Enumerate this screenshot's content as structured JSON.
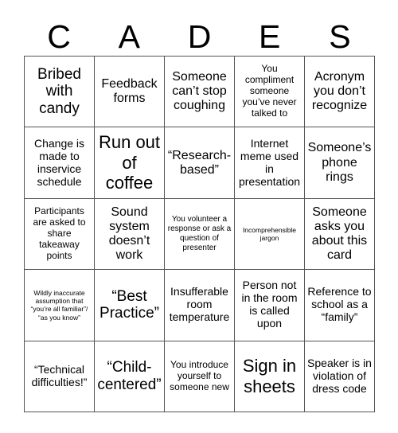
{
  "card": {
    "header_letters": [
      "C",
      "A",
      "D",
      "E",
      "S"
    ],
    "colors": {
      "background": "#ffffff",
      "text": "#000000",
      "grid_line": "#555555"
    },
    "rows": [
      [
        {
          "text": "Bribed with candy",
          "size": "xl"
        },
        {
          "text": "Feedback forms",
          "size": "lg"
        },
        {
          "text": "Someone can’t stop coughing",
          "size": "lg"
        },
        {
          "text": "You compliment someone you’ve never talked to",
          "size": "sm"
        },
        {
          "text": "Acronym you don’t recognize",
          "size": "lg"
        }
      ],
      [
        {
          "text": "Change is made to inservice schedule",
          "size": "md"
        },
        {
          "text": "Run out of coffee",
          "size": "xxl"
        },
        {
          "text": "“Research-based”",
          "size": "lg"
        },
        {
          "text": "Internet meme used in presentation",
          "size": "md"
        },
        {
          "text": "Someone’s phone rings",
          "size": "lg"
        }
      ],
      [
        {
          "text": "Participants are asked to share takeaway points",
          "size": "sm"
        },
        {
          "text": "Sound system doesn’t work",
          "size": "lg"
        },
        {
          "text": "You volunteer a response or ask a question of presenter",
          "size": "xs"
        },
        {
          "text": "Incomprehensible jargon",
          "size": "xxs"
        },
        {
          "text": "Someone asks you about this card",
          "size": "lg"
        }
      ],
      [
        {
          "text": "Wildly inaccurate assumption that “you’re all familiar”/ “as you know”",
          "size": "xxs"
        },
        {
          "text": "“Best Practice”",
          "size": "xl"
        },
        {
          "text": "Insufferable room temperature",
          "size": "md"
        },
        {
          "text": "Person not in the room is called upon",
          "size": "md"
        },
        {
          "text": "Reference to school as a “family”",
          "size": "md"
        }
      ],
      [
        {
          "text": "“Technical difficulties!”",
          "size": "md"
        },
        {
          "text": "“Child-centered”",
          "size": "xl"
        },
        {
          "text": "You introduce yourself to someone new",
          "size": "sm"
        },
        {
          "text": "Sign in sheets",
          "size": "xxl"
        },
        {
          "text": "Speaker is in violation of dress code",
          "size": "md"
        }
      ]
    ]
  }
}
